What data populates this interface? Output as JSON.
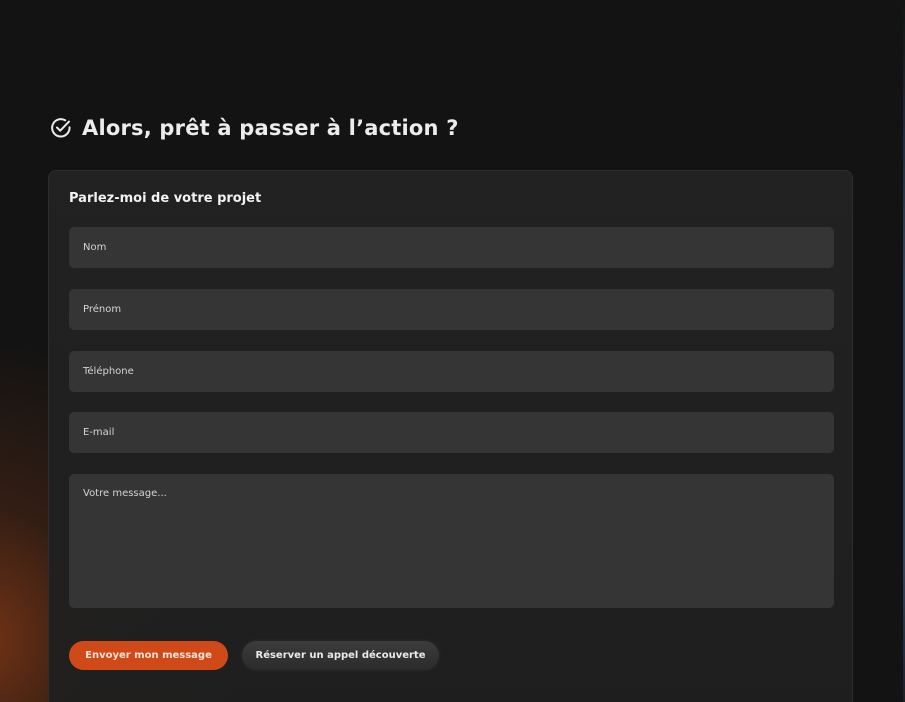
{
  "section": {
    "title": "Alors, prêt à passer à l’action ?",
    "icon": "check-circle-icon"
  },
  "form": {
    "title": "Parlez-moi de votre projet",
    "fields": {
      "nom": {
        "placeholder": "Nom",
        "value": ""
      },
      "prenom": {
        "placeholder": "Prénom",
        "value": ""
      },
      "telephone": {
        "placeholder": "Téléphone",
        "value": ""
      },
      "email": {
        "placeholder": "E-mail",
        "value": ""
      },
      "message": {
        "placeholder": "Votre message...",
        "value": ""
      }
    },
    "buttons": {
      "send_label": "Envoyer mon message",
      "call_label": "Réserver un appel découverte"
    }
  },
  "colors": {
    "accent": "#cf4a18",
    "background": "#131313",
    "card": "#222222",
    "field": "#353535"
  }
}
